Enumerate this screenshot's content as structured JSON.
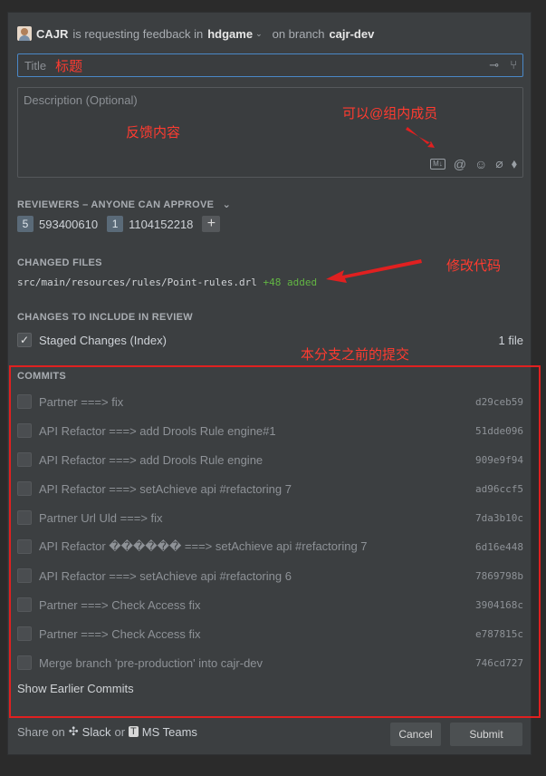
{
  "header": {
    "user": "CAJR",
    "mid_text": "is requesting feedback in",
    "repo": "hdgame",
    "branch_prefix": "on branch",
    "branch": "cajr-dev"
  },
  "title_field": {
    "placeholder": "Title",
    "annotation": "标题"
  },
  "description_field": {
    "placeholder": "Description (Optional)",
    "annotation": "反馈内容",
    "mention_annotation": "可以@组内成员"
  },
  "reviewers": {
    "heading": "REVIEWERS – ANYONE CAN APPROVE",
    "items": [
      {
        "badge": "5",
        "name": "593400610"
      },
      {
        "badge": "1",
        "name": "1104152218"
      }
    ]
  },
  "changed_files": {
    "heading": "CHANGED FILES",
    "path": "src/main/resources/rules/Point-rules.drl",
    "delta": "+48 added",
    "annotation": "修改代码"
  },
  "changes_to_include": {
    "heading": "CHANGES TO INCLUDE IN REVIEW",
    "item": "Staged Changes (Index)",
    "count": "1 file"
  },
  "commits": {
    "heading": "COMMITS",
    "annotation": "本分支之前的提交",
    "items": [
      {
        "message": "Partner ===> fix",
        "hash": "d29ceb59"
      },
      {
        "message": "API Refactor ===> add Drools Rule engine#1",
        "hash": "51dde096"
      },
      {
        "message": "API Refactor ===> add Drools Rule engine",
        "hash": "909e9f94"
      },
      {
        "message": "API Refactor ===> setAchieve api #refactoring 7",
        "hash": "ad96ccf5"
      },
      {
        "message": "Partner Url Uld ===> fix",
        "hash": "7da3b10c"
      },
      {
        "message": "API Refactor ������ ===> setAchieve api #refactoring 7",
        "hash": "6d16e448"
      },
      {
        "message": "API Refactor ===> setAchieve api #refactoring 6",
        "hash": "7869798b"
      },
      {
        "message": "Partner ===> Check Access fix",
        "hash": "3904168c"
      },
      {
        "message": "Partner ===> Check Access fix",
        "hash": "e787815c"
      },
      {
        "message": "Merge branch 'pre-production' into cajr-dev",
        "hash": "746cd727"
      }
    ],
    "show_earlier": "Show Earlier Commits"
  },
  "footer": {
    "share_on": "Share on",
    "slack": "Slack",
    "or": "or",
    "teams": "MS Teams",
    "cancel": "Cancel",
    "submit": "Submit"
  },
  "icons": [
    "user-avatar-icon",
    "chevron-down-icon",
    "commit-icon",
    "branch-icon",
    "markdown-icon",
    "at-icon",
    "emoji-icon",
    "attach-icon",
    "tag-icon",
    "plus-icon",
    "checkbox-icon",
    "slack-icon",
    "teams-icon"
  ],
  "colors": {
    "annotation_red": "#ff3b30",
    "focus_blue": "#4a88c7",
    "added_green": "#62b543"
  }
}
